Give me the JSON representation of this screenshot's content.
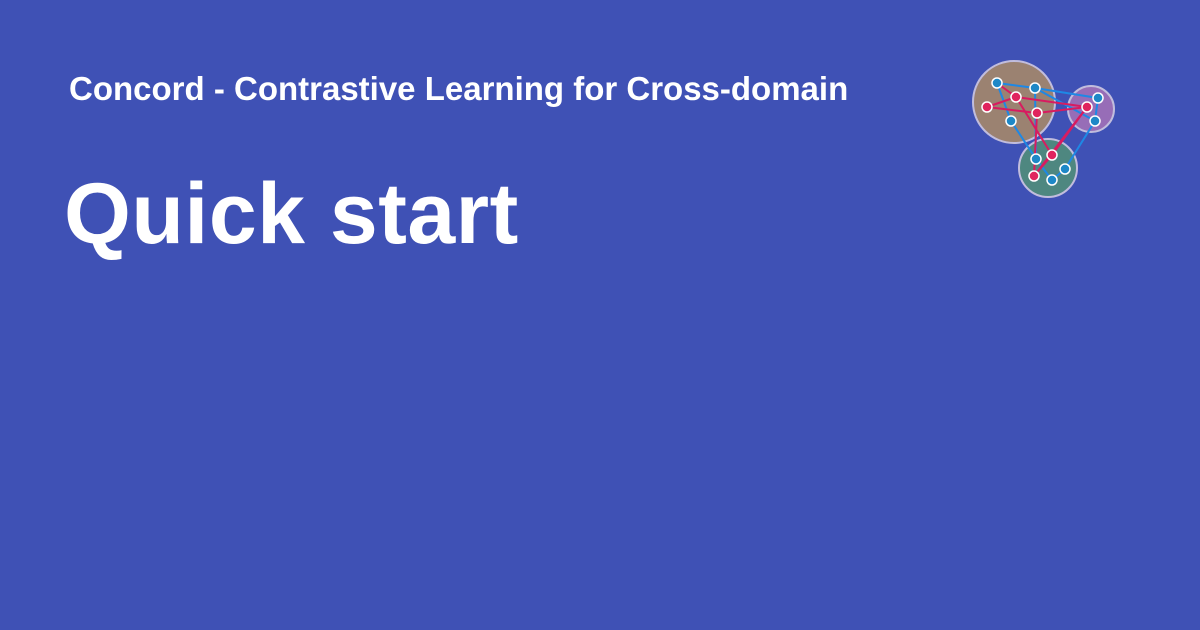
{
  "social_card": {
    "site_name": "Concord - Contrastive Learning for Cross-domain",
    "page_title": "Quick start",
    "logo_icon": "graph-network-icon"
  },
  "colors": {
    "background": "#3f51b5",
    "text": "#ffffff",
    "cluster_brown": "#a0856e",
    "cluster_purple": "#9c6fb8",
    "cluster_green": "#4f8a7e",
    "node_red": "#e0245e",
    "node_blue": "#1e88c7",
    "edge_red": "#d81b60",
    "edge_blue": "#1e88e5"
  }
}
